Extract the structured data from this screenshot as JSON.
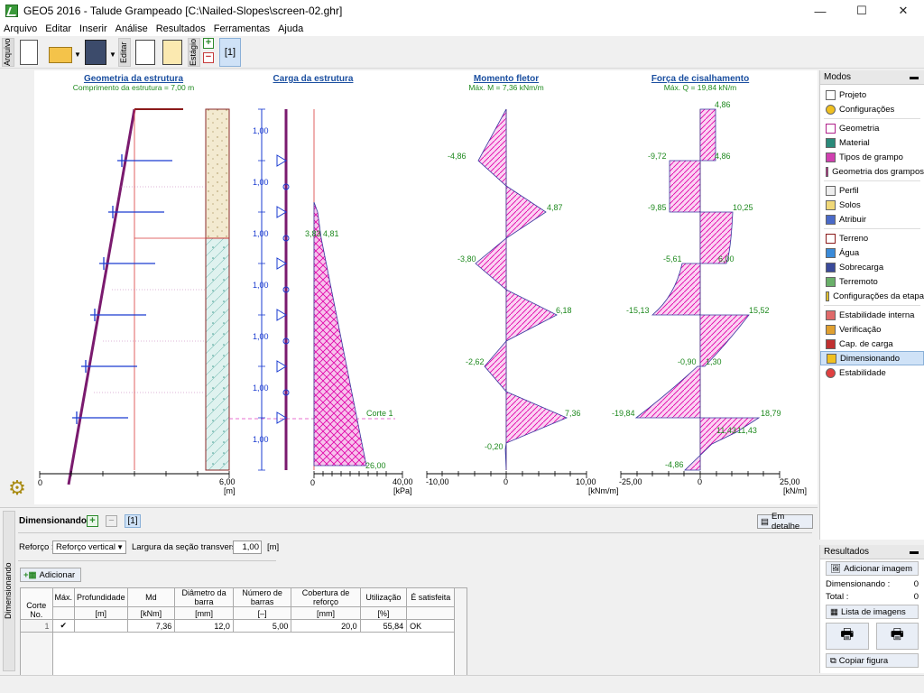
{
  "window": {
    "title": "GEO5 2016 - Talude Grampeado [C:\\Nailed-Slopes\\screen-02.ghr]",
    "minimize": "—",
    "maximize": "☐",
    "close": "✕"
  },
  "menu": [
    "Arquivo",
    "Editar",
    "Inserir",
    "Análise",
    "Resultados",
    "Ferramentas",
    "Ajuda"
  ],
  "toolbar": {
    "file_label": "Arquivo",
    "edit_label": "Editar",
    "stage_label": "Estágio",
    "stage_value": "[1]",
    "icons": [
      "new-document-icon",
      "open-folder-icon",
      "save-icon",
      "copy-icon",
      "paste-icon"
    ]
  },
  "charts": {
    "geometry": {
      "title": "Geometria da estrutura",
      "subtitle": "Comprimento da estrutura = 7,00 m",
      "axis_min": "0",
      "axis_max": "6,00",
      "unit": "[m]"
    },
    "load": {
      "title": "Carga da estrutura",
      "spacing": [
        "1,00",
        "1,00",
        "1,00",
        "1,00",
        "1,00",
        "1,00",
        "1,00"
      ],
      "labels": [
        "3,83",
        "4,81",
        "26,00"
      ],
      "section_label": "Corte 1",
      "axis_min": "0",
      "axis_max": "40,00",
      "unit": "[kPa]"
    },
    "moment": {
      "title": "Momento fletor",
      "subtitle": "Máx. M = 7,36 kNm/m",
      "labels": [
        "-4,86",
        "4,87",
        "-3,80",
        "6,18",
        "-2,62",
        "7,36",
        "-0,20"
      ],
      "axis_min": "-10,00",
      "axis_zero": "0",
      "axis_max": "10,00",
      "unit": "[kNm/m]"
    },
    "shear": {
      "title": "Força de cisalhamento",
      "subtitle": "Máx. Q = 19,84 kN/m",
      "labels": [
        "4,86",
        "-9,72",
        "4,86",
        "-9,85",
        "10,25",
        "-5,61",
        "6,00",
        "-15,13",
        "15,52",
        "-0,90",
        "1,30",
        "-19,84",
        "18,79",
        "11,43",
        "11,43",
        "-4,86"
      ],
      "axis_min": "-25,00",
      "axis_zero": "0",
      "axis_max": "25,00",
      "unit": "[kN/m]"
    }
  },
  "chart_data": [
    {
      "type": "line",
      "title": "Momento fletor",
      "subtitle": "Máx. M = 7,36 kNm/m",
      "xlabel": "[kNm/m]",
      "xlim": [
        -10,
        10
      ],
      "x": [
        0,
        -4.86,
        4.87,
        -3.8,
        6.18,
        -2.62,
        7.36,
        -0.2,
        0
      ],
      "y": [
        0,
        1,
        2,
        3,
        4,
        5,
        6,
        6.7,
        7
      ]
    },
    {
      "type": "area",
      "title": "Força de cisalhamento",
      "subtitle": "Máx. Q = 19,84 kN/m",
      "xlabel": "[kN/m]",
      "xlim": [
        -25,
        25
      ],
      "x": [
        4.86,
        4.86,
        -9.72,
        -9.85,
        10.25,
        -5.61,
        6.0,
        -15.13,
        15.52,
        -0.9,
        1.3,
        -19.84,
        18.79,
        11.43,
        -4.86
      ],
      "y": [
        0,
        1,
        1,
        2,
        2,
        3,
        3,
        4,
        4,
        5,
        5,
        6,
        6,
        6.3,
        7
      ]
    },
    {
      "type": "area",
      "title": "Carga da estrutura",
      "xlabel": "[kPa]",
      "xlim": [
        0,
        40
      ],
      "x": [
        0,
        3.83,
        4.81,
        26.0
      ],
      "y": [
        1.8,
        2.5,
        2.5,
        7.0
      ]
    }
  ],
  "modes": {
    "header": "Modos",
    "groups": [
      [
        {
          "label": "Projeto",
          "icon": "project-icon"
        },
        {
          "label": "Configurações",
          "icon": "settings-icon"
        }
      ],
      [
        {
          "label": "Geometria",
          "icon": "geometry-icon"
        },
        {
          "label": "Material",
          "icon": "material-icon"
        },
        {
          "label": "Tipos de grampo",
          "icon": "nail-types-icon"
        },
        {
          "label": "Geometria dos grampos",
          "icon": "nail-geometry-icon"
        }
      ],
      [
        {
          "label": "Perfil",
          "icon": "profile-icon"
        },
        {
          "label": "Solos",
          "icon": "soils-icon"
        },
        {
          "label": "Atribuir",
          "icon": "assign-icon"
        }
      ],
      [
        {
          "label": "Terreno",
          "icon": "terrain-icon"
        },
        {
          "label": "Água",
          "icon": "water-icon"
        },
        {
          "label": "Sobrecarga",
          "icon": "surcharge-icon"
        },
        {
          "label": "Terremoto",
          "icon": "earthquake-icon"
        },
        {
          "label": "Configurações da etapa",
          "icon": "stage-settings-icon"
        }
      ],
      [
        {
          "label": "Estabilidade interna",
          "icon": "internal-stability-icon"
        },
        {
          "label": "Verificação",
          "icon": "verification-icon"
        },
        {
          "label": "Cap. de carga",
          "icon": "bearing-capacity-icon"
        },
        {
          "label": "Dimensionando",
          "icon": "dimensioning-icon",
          "active": true
        },
        {
          "label": "Estabilidade",
          "icon": "stability-icon"
        }
      ]
    ]
  },
  "results": {
    "header": "Resultados",
    "add_image": "Adicionar imagem",
    "dimensioning_label": "Dimensionando :",
    "dimensioning_count": "0",
    "total_label": "Total :",
    "total_count": "0",
    "image_list": "Lista de imagens",
    "copy_figure": "Copiar figura"
  },
  "bottom": {
    "tab_label": "Dimensionando",
    "header_label": "Dimensionando :",
    "stage_value": "[1]",
    "detail_button": "Em detalhe",
    "reinforcement_label": "Reforço :",
    "reinforcement_value": "Reforço vertical",
    "width_label": "Largura da seção transversal :",
    "width_value": "1,00",
    "width_unit": "[m]",
    "add_button": "Adicionar",
    "table": {
      "headers": [
        "Corte No.",
        "Máx.",
        "Profundidade",
        "Md",
        "Diâmetro da barra",
        "Número de barras",
        "Cobertura de reforço",
        "Utilização",
        "É satisfeita"
      ],
      "units": [
        "",
        "",
        "[m]",
        "[kNm]",
        "[mm]",
        "[–]",
        "[mm]",
        "[%]",
        ""
      ],
      "rows": [
        {
          "no": "1",
          "max": "✔",
          "depth": "",
          "md": "7,36",
          "diameter": "12,0",
          "bars": "5,00",
          "cover": "20,0",
          "util": "55,84",
          "ok": "OK"
        }
      ]
    }
  }
}
